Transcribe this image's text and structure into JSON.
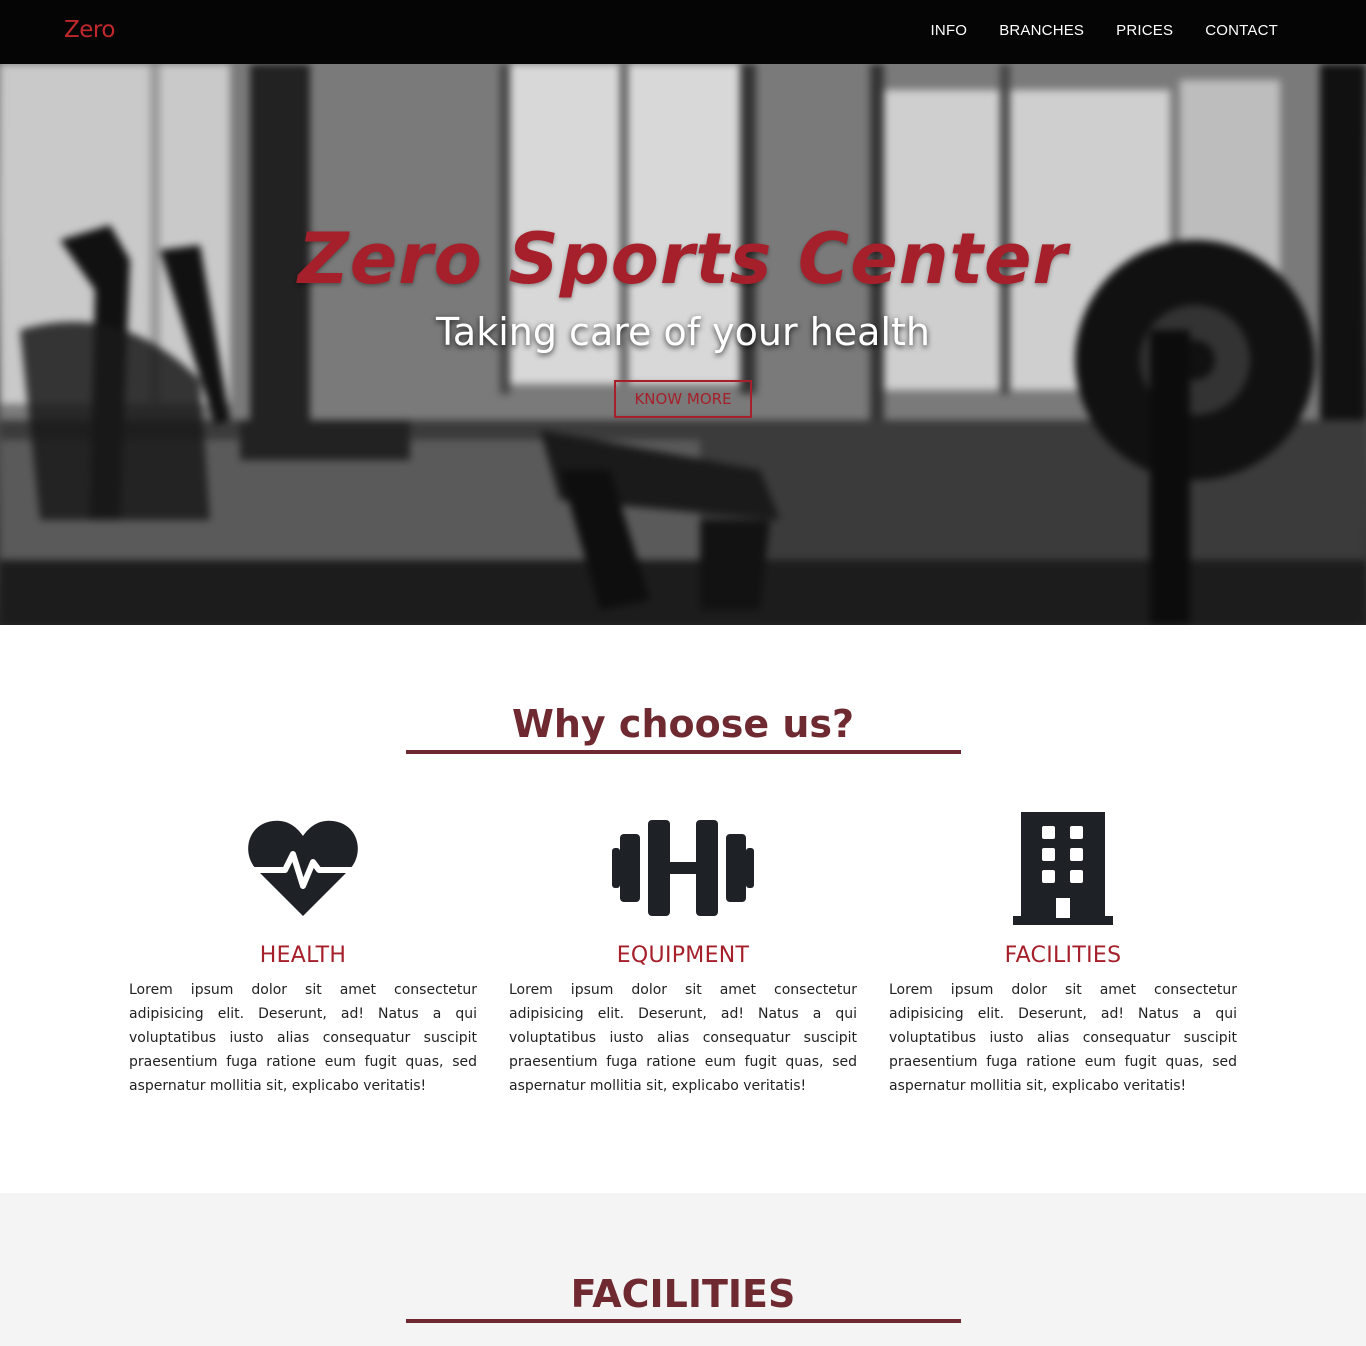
{
  "nav": {
    "brand": "Zero",
    "links": [
      "INFO",
      "BRANCHES",
      "PRICES",
      "CONTACT"
    ]
  },
  "hero": {
    "title": "Zero Sports Center",
    "subtitle": "Taking care of your health",
    "button_label": "KNOW MORE"
  },
  "why": {
    "title": "Why choose us?",
    "features": [
      {
        "icon": "heartbeat-icon",
        "title": "HEALTH",
        "text": "Lorem ipsum dolor sit amet consectetur adipisicing elit. Deserunt, ad! Natus a qui voluptatibus iusto alias consequatur suscipit praesentium fuga ratione eum fugit quas, sed aspernatur mollitia sit, explicabo veritatis!"
      },
      {
        "icon": "dumbbell-icon",
        "title": "EQUIPMENT",
        "text": "Lorem ipsum dolor sit amet consectetur adipisicing elit. Deserunt, ad! Natus a qui voluptatibus iusto alias consequatur suscipit praesentium fuga ratione eum fugit quas, sed aspernatur mollitia sit, explicabo veritatis!"
      },
      {
        "icon": "building-icon",
        "title": "FACILITIES",
        "text": "Lorem ipsum dolor sit amet consectetur adipisicing elit. Deserunt, ad! Natus a qui voluptatibus iusto alias consequatur suscipit praesentium fuga ratione eum fugit quas, sed aspernatur mollitia sit, explicabo veritatis!"
      }
    ]
  },
  "facilities": {
    "title": "FACILITIES"
  },
  "colors": {
    "accent": "#a5202a",
    "heading": "#6e2a30",
    "icon": "#1e2126",
    "nav_bg": "#050505"
  }
}
